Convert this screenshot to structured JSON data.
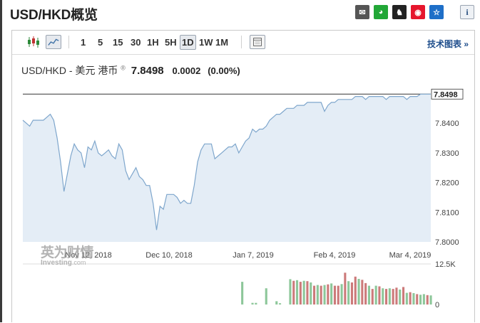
{
  "header": {
    "title": "USD/HKD概览",
    "share_icons": [
      {
        "name": "email-icon",
        "glyph": "✉",
        "color": "#555555"
      },
      {
        "name": "wechat-icon",
        "glyph": "◕",
        "color": "#22a737"
      },
      {
        "name": "qq-icon",
        "glyph": "♞",
        "color": "#222222"
      },
      {
        "name": "weibo-icon",
        "glyph": "◉",
        "color": "#e6162d"
      },
      {
        "name": "favorite-icon",
        "glyph": "☆",
        "color": "#1e6fc8"
      }
    ],
    "info_glyph": "i"
  },
  "toolbar": {
    "timeframes": [
      "1",
      "5",
      "15",
      "30",
      "1H",
      "5H",
      "1D",
      "1W",
      "1M"
    ],
    "selected": "1D",
    "advanced_chart": "技术图表 »"
  },
  "quote": {
    "name": "USD/HKD - 美元 港币",
    "marker": "®",
    "price": "7.8498",
    "change": "0.0002",
    "change_pct": "(0.00%)"
  },
  "watermark": {
    "cn": "英为财情",
    "en": "Investing",
    "en_suffix": ".com"
  },
  "chart_data": {
    "type": "area",
    "price": [
      7.841,
      7.84,
      7.839,
      7.841,
      7.841,
      7.841,
      7.841,
      7.842,
      7.843,
      7.841,
      7.835,
      7.827,
      7.817,
      7.823,
      7.829,
      7.833,
      7.831,
      7.83,
      7.825,
      7.832,
      7.831,
      7.834,
      7.83,
      7.829,
      7.83,
      7.831,
      7.829,
      7.828,
      7.833,
      7.831,
      7.824,
      7.821,
      7.823,
      7.825,
      7.822,
      7.821,
      7.819,
      7.819,
      7.813,
      7.804,
      7.812,
      7.811,
      7.816,
      7.816,
      7.816,
      7.815,
      7.813,
      7.814,
      7.813,
      7.813,
      7.819,
      7.827,
      7.831,
      7.833,
      7.833,
      7.833,
      7.828,
      7.829,
      7.83,
      7.831,
      7.832,
      7.832,
      7.833,
      7.83,
      7.832,
      7.834,
      7.835,
      7.838,
      7.837,
      7.838,
      7.838,
      7.839,
      7.841,
      7.842,
      7.843,
      7.843,
      7.844,
      7.845,
      7.845,
      7.845,
      7.846,
      7.846,
      7.846,
      7.847,
      7.847,
      7.847,
      7.847,
      7.847,
      7.844,
      7.846,
      7.847,
      7.847,
      7.848,
      7.848,
      7.848,
      7.848,
      7.848,
      7.849,
      7.849,
      7.849,
      7.848,
      7.849,
      7.849,
      7.849,
      7.849,
      7.849,
      7.848,
      7.849,
      7.849,
      7.849,
      7.849,
      7.849,
      7.848,
      7.849,
      7.849,
      7.849,
      7.8498,
      7.8498,
      7.8498,
      7.8498
    ],
    "last": "7.8498",
    "y_ticks": [
      "7.8400",
      "7.8300",
      "7.8200",
      "7.8100",
      "7.8000"
    ],
    "ylim": [
      7.8,
      7.8525
    ],
    "x_ticks": [
      "Nov 12, 2018",
      "Dec 10, 2018",
      "Jan 7, 2019",
      "Feb 4, 2019",
      "Mar 4, 2019"
    ],
    "volume": {
      "y_ticks": [
        "12.5K",
        "0"
      ],
      "ylim": [
        0,
        12500
      ],
      "values": [
        0,
        0,
        0,
        0,
        0,
        0,
        0,
        0,
        0,
        0,
        0,
        0,
        0,
        0,
        0,
        0,
        0,
        0,
        0,
        0,
        0,
        0,
        0,
        0,
        0,
        0,
        0,
        0,
        0,
        0,
        0,
        0,
        0,
        0,
        0,
        0,
        0,
        0,
        0,
        0,
        0,
        0,
        0,
        0,
        0,
        0,
        0,
        0,
        0,
        0,
        0,
        0,
        0,
        0,
        0,
        0,
        0,
        0,
        0,
        0,
        0,
        0,
        0,
        0,
        7000,
        0,
        0,
        500,
        500,
        0,
        0,
        5000,
        0,
        0,
        1000,
        400,
        0,
        0,
        7800,
        7300,
        7500,
        7000,
        7300,
        7200,
        6800,
        5800,
        6000,
        5800,
        6000,
        6200,
        6500,
        5800,
        5800,
        6300,
        9800,
        7200,
        6800,
        8600,
        7900,
        7600,
        6600,
        5800,
        4800,
        5800,
        5600,
        5000,
        4800,
        5000,
        4800,
        5200,
        4600,
        5400,
        3600,
        3800,
        3500,
        3200,
        3000,
        3200,
        2900,
        2800
      ],
      "up": [
        0,
        0,
        0,
        0,
        0,
        0,
        0,
        0,
        0,
        0,
        0,
        0,
        0,
        0,
        0,
        0,
        0,
        0,
        0,
        0,
        0,
        0,
        0,
        0,
        0,
        0,
        0,
        0,
        0,
        0,
        0,
        0,
        0,
        0,
        0,
        0,
        0,
        0,
        0,
        0,
        0,
        0,
        0,
        0,
        0,
        0,
        0,
        0,
        0,
        0,
        0,
        0,
        0,
        0,
        0,
        0,
        0,
        0,
        0,
        0,
        0,
        0,
        0,
        0,
        1,
        0,
        0,
        1,
        1,
        0,
        0,
        1,
        0,
        0,
        1,
        1,
        0,
        0,
        1,
        0,
        1,
        0,
        1,
        0,
        1,
        0,
        1,
        0,
        1,
        0,
        1,
        0,
        0,
        1,
        0,
        1,
        0,
        0,
        1,
        0,
        0,
        1,
        0,
        1,
        0,
        1,
        0,
        1,
        0,
        0,
        1,
        0,
        1,
        0,
        1,
        0,
        1,
        1,
        0,
        1
      ]
    }
  },
  "colors": {
    "line": "#7ea6cc",
    "fill": "#e4edf6",
    "up": "#8dc79a",
    "down": "#cc7a7a",
    "grid": "#e8e8e8",
    "axis_text": "#444444"
  }
}
